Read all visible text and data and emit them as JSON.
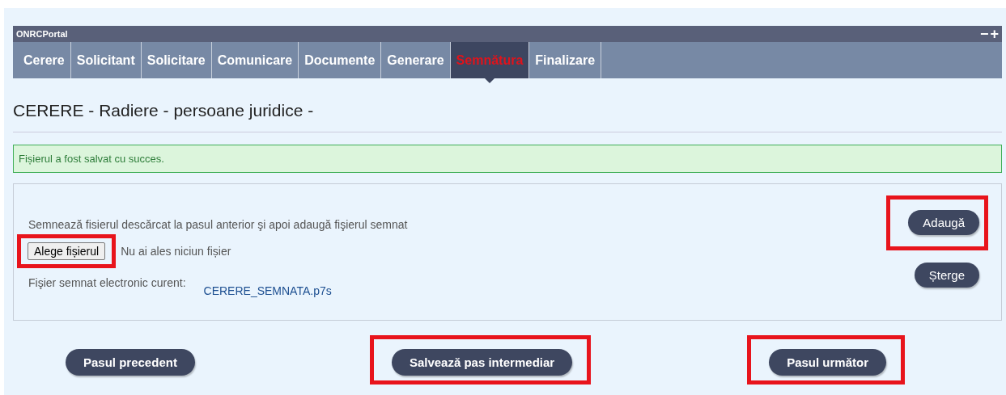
{
  "portal": {
    "title": "ONRCPortal",
    "controls": [
      "−",
      "+"
    ]
  },
  "tabs": [
    {
      "label": "Cerere",
      "selected": false
    },
    {
      "label": "Solicitant",
      "selected": false
    },
    {
      "label": "Solicitare",
      "selected": false
    },
    {
      "label": "Comunicare",
      "selected": false
    },
    {
      "label": "Documente",
      "selected": false
    },
    {
      "label": "Generare",
      "selected": false
    },
    {
      "label": "Semnătura",
      "selected": true
    },
    {
      "label": "Finalizare",
      "selected": false
    }
  ],
  "heading": "CERERE - Radiere - persoane juridice -",
  "success_message": "Fișierul a fost salvat cu succes.",
  "upload": {
    "instruction": "Semnează fisierul descărcat la pasul anterior şi apoi adaugă fişierul semnat",
    "choose_button": {
      "label": "Alege fișierul",
      "highlighted": true
    },
    "no_file_text": "Nu ai ales niciun fișier",
    "add_button": {
      "label": "Adaugă",
      "highlighted": true
    },
    "current_label": "Fişier semnat electronic curent:",
    "current_file": "CERERE_SEMNATA.p7s",
    "delete_button": {
      "label": "Șterge",
      "highlighted": false
    }
  },
  "footer_buttons": [
    {
      "label": "Pasul precedent",
      "highlighted": false
    },
    {
      "label": "Salvează pas intermediar",
      "highlighted": true
    },
    {
      "label": "Pasul următor",
      "highlighted": true
    }
  ]
}
